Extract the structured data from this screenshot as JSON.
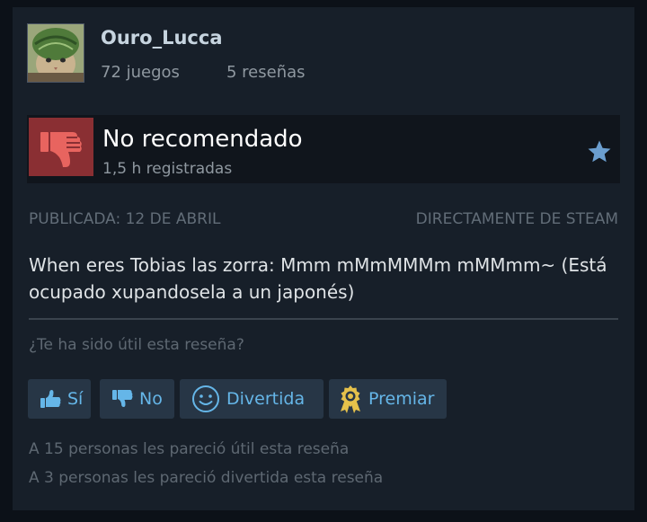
{
  "author": {
    "name": "Ouro_Lucca",
    "games_owned": "72 juegos",
    "reviews_count": "5 reseñas"
  },
  "review": {
    "verdict": "No recomendado",
    "hours": "1,5 h registradas",
    "posted": "PUBLICADA: 12 DE ABRIL",
    "source": "DIRECTAMENTE DE STEAM",
    "text": "When eres Tobias las zorra: Mmm mMmMMMm mMMmm~ (Está ocupado xupandosela a un japonés)"
  },
  "feedback": {
    "question": "¿Te ha sido útil esta reseña?",
    "yes_label": "Sí",
    "no_label": "No",
    "funny_label": "Divertida",
    "award_label": "Premiar"
  },
  "stats": {
    "helpful": "A 15 personas les pareció útil esta reseña",
    "funny": "A 3 personas les pareció divertida esta reseña"
  },
  "colors": {
    "page_bg": "#0c1118",
    "card_bg": "#171f29",
    "not_recommended": "#8a2f33",
    "button_text": "#65b6e8",
    "star": "#6b9ecf",
    "award": "#e5c14b"
  },
  "icons": {
    "avatar": "cat-with-melon-helmet-avatar",
    "verdict": "thumbs-down-icon",
    "favorite": "star-icon",
    "yes": "thumbs-up-icon",
    "no": "thumbs-down-icon",
    "funny": "smiley-icon",
    "award": "award-medal-icon"
  }
}
